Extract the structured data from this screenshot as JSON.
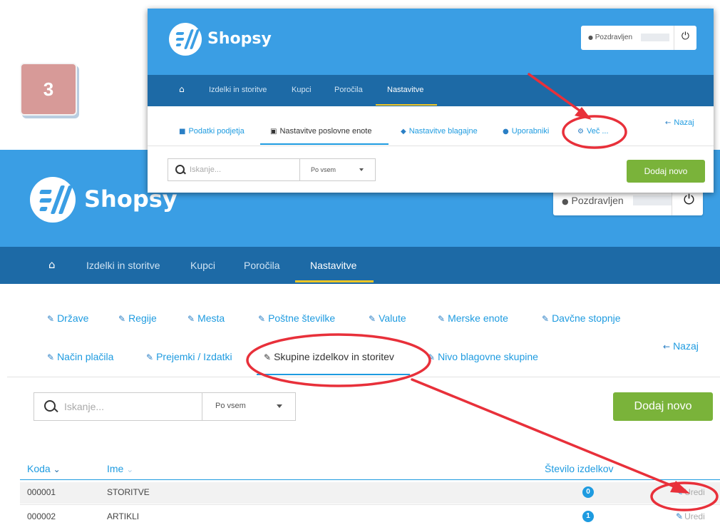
{
  "app": {
    "name": "Shopsy"
  },
  "step_badge": "3",
  "header": {
    "greeting": "Pozdravljen",
    "user_icon": "user-icon",
    "power_icon": "power-icon"
  },
  "nav": {
    "items": [
      {
        "label": "Izdelki in storitve"
      },
      {
        "label": "Kupci"
      },
      {
        "label": "Poročila"
      },
      {
        "label": "Nastavitve",
        "active": true
      }
    ]
  },
  "inset_tabs": [
    {
      "label": "Podatki podjetja",
      "icon": "book-icon"
    },
    {
      "label": "Nastavitve poslovne enote",
      "icon": "cart-icon",
      "active": true
    },
    {
      "label": "Nastavitve blagajne",
      "icon": "tag-icon"
    },
    {
      "label": "Uporabniki",
      "icon": "users-icon"
    },
    {
      "label": "Več ...",
      "icon": "cogs-icon"
    }
  ],
  "main_tabs_row1": [
    {
      "label": "Države"
    },
    {
      "label": "Regije"
    },
    {
      "label": "Mesta"
    },
    {
      "label": "Poštne številke"
    },
    {
      "label": "Valute"
    },
    {
      "label": "Merske enote"
    },
    {
      "label": "Davčne stopnje"
    }
  ],
  "main_tabs_row2": [
    {
      "label": "Način plačila"
    },
    {
      "label": "Prejemki / Izdatki"
    },
    {
      "label": "Skupine izdelkov in storitev",
      "active": true
    },
    {
      "label": "Nivo blagovne skupine"
    }
  ],
  "back_label": "Nazaj",
  "search": {
    "placeholder": "Iskanje...",
    "scope": "Po vsem"
  },
  "add_button": "Dodaj novo",
  "table": {
    "columns": [
      "Koda",
      "Ime",
      "Število izdelkov"
    ],
    "rows": [
      {
        "code": "000001",
        "name": "STORITVE",
        "count": "0",
        "action": "Uredi"
      },
      {
        "code": "000002",
        "name": "ARTIKLI",
        "count": "1",
        "action": "Uredi"
      }
    ]
  },
  "colors": {
    "header": "#3a9ee4",
    "nav": "#1d6aa6",
    "accent": "#1e9be0",
    "add_button": "#7ab33a",
    "nav_underline": "#f3c623",
    "annotation": "#e8303a"
  }
}
